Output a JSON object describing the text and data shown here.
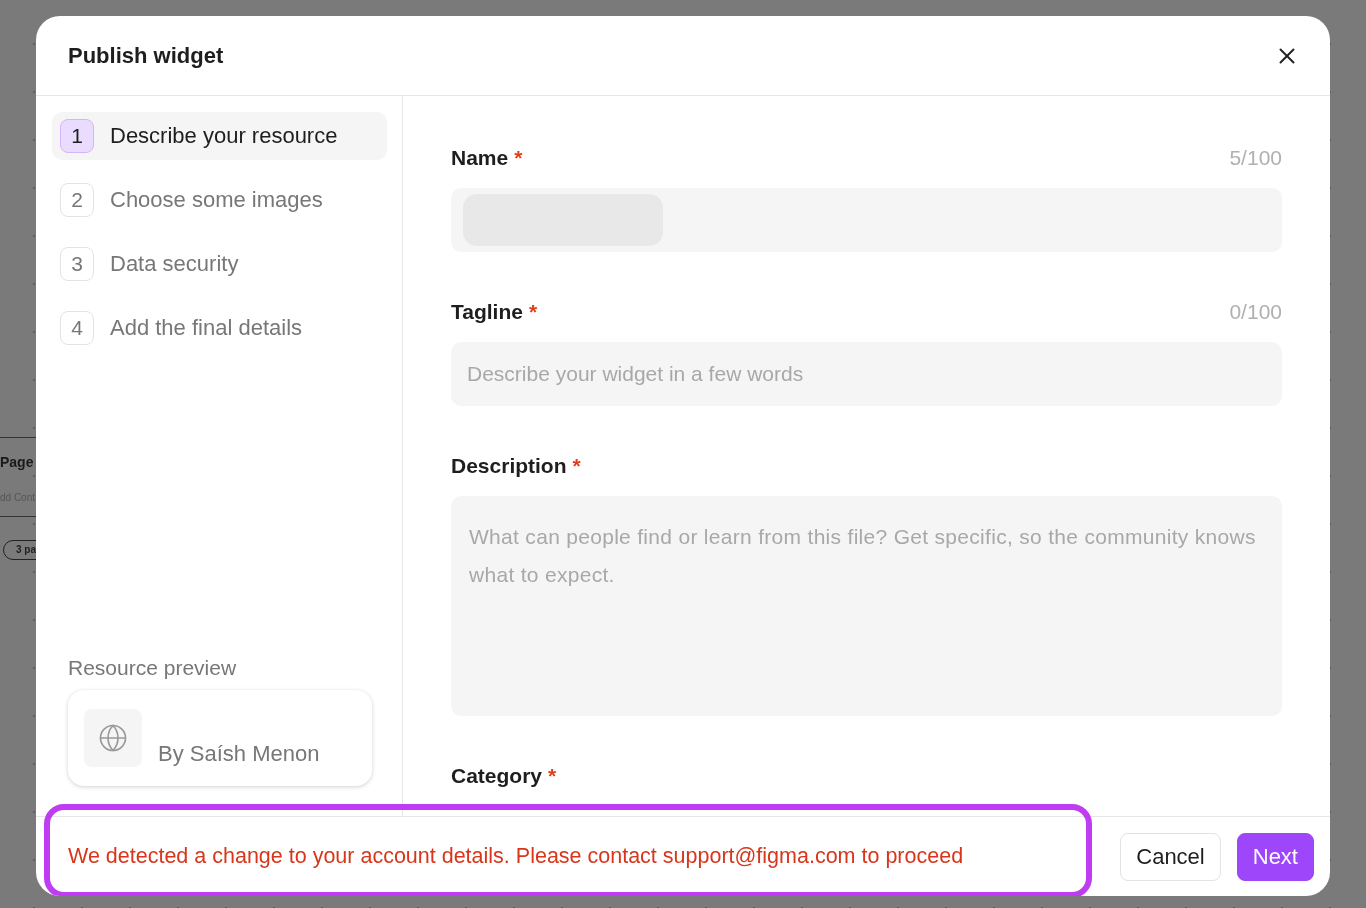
{
  "canvas": {
    "card_title": "Page",
    "card_subtitle": "dd Cont",
    "pill": "3 pa"
  },
  "dialog": {
    "title": "Publish widget"
  },
  "steps": [
    {
      "number": "1",
      "label": "Describe your resource",
      "selected": true
    },
    {
      "number": "2",
      "label": "Choose some images",
      "selected": false
    },
    {
      "number": "3",
      "label": "Data security",
      "selected": false
    },
    {
      "number": "4",
      "label": "Add the final details",
      "selected": false
    }
  ],
  "preview": {
    "heading": "Resource preview",
    "author": "By Saísh Menon"
  },
  "fields": [
    {
      "kind": "input",
      "label": "Name",
      "required_mark": "*",
      "counter": "5/100",
      "redacted": true
    },
    {
      "kind": "input",
      "label": "Tagline",
      "required_mark": "*",
      "counter": "0/100",
      "placeholder": "Describe your widget in a few words"
    },
    {
      "kind": "textarea",
      "label": "Description",
      "required_mark": "*",
      "placeholder": "What can people find or learn from this file? Get specific, so the community knows what to expect."
    },
    {
      "kind": "heading",
      "label": "Category",
      "required_mark": "*"
    }
  ],
  "footer": {
    "error": "We detected a change to your account details. Please contact support@figma.com to proceed",
    "highlighted": true,
    "buttons": [
      {
        "label": "Cancel",
        "kind": "secondary"
      },
      {
        "label": "Next",
        "kind": "primary"
      }
    ]
  }
}
